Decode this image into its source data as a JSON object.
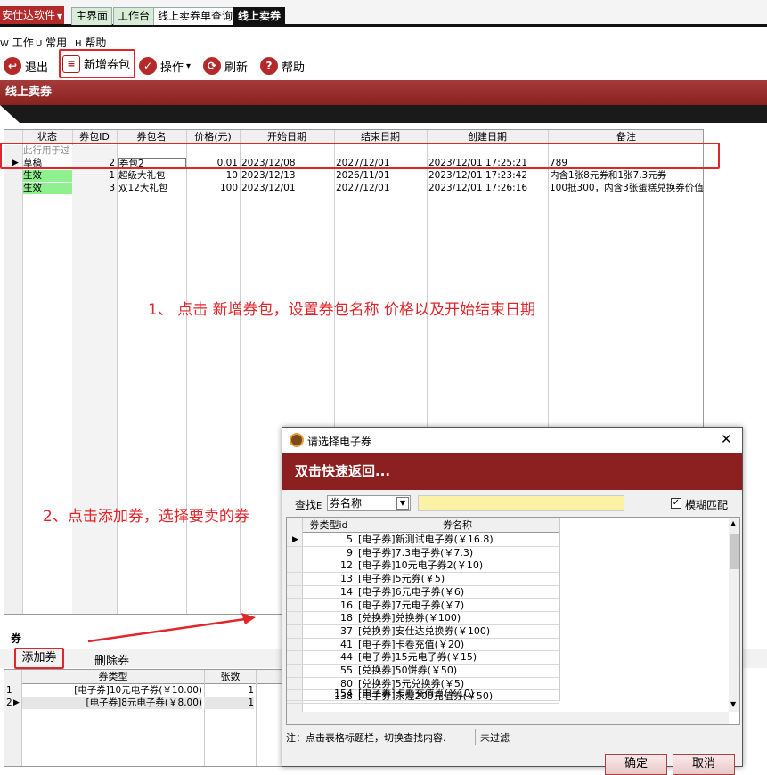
{
  "app": {
    "title": "安仕达软件",
    "dropdown_glyph": "▼"
  },
  "tabs": [
    {
      "label": "主界面",
      "active": false
    },
    {
      "label": "工作台",
      "active": false
    },
    {
      "label": "线上卖券单查询",
      "active": false
    },
    {
      "label": "线上卖券",
      "active": true
    }
  ],
  "menu": [
    {
      "key": "W",
      "label": "工作"
    },
    {
      "key": "U",
      "label": "常用"
    },
    {
      "key": "H",
      "label": "帮助"
    }
  ],
  "toolbar": {
    "exit": "退出",
    "new_package": "新增券包",
    "operate": "操作",
    "operate_caret": "▾",
    "refresh": "刷新",
    "help": "帮助"
  },
  "section_title": "线上卖券",
  "grid": {
    "columns": [
      "状态",
      "券包ID",
      "券包名",
      "价格(元)",
      "开始日期",
      "结束日期",
      "创建日期",
      "备注"
    ],
    "filter_row_text": "此行用于过",
    "rows": [
      {
        "status": "草稿",
        "id": "2",
        "name": "券包2",
        "price": "0.01",
        "start": "2023/12/08",
        "end": "2027/12/01",
        "created": "2023/12/01 17:25:21",
        "note": "789",
        "current": true
      },
      {
        "status": "生效",
        "id": "1",
        "name": "超级大礼包",
        "price": "10",
        "start": "2023/12/13",
        "end": "2026/11/01",
        "created": "2023/12/01 17:23:42",
        "note": "内含1张8元券和1张7.3元券",
        "current": false
      },
      {
        "status": "生效",
        "id": "3",
        "name": "双12大礼包",
        "price": "100",
        "start": "2023/12/01",
        "end": "2027/12/01",
        "created": "2023/12/01 17:26:16",
        "note": "100抵300，内含3张蛋糕兑换券价值3",
        "current": false
      }
    ]
  },
  "annotations": {
    "step1": "1、 点击 新增券包，设置券包名称 价格以及开始结束日期",
    "step2": "2、点击添加券，选择要卖的券"
  },
  "coupon_panel": {
    "title": "券",
    "add_button": "添加券",
    "remove_button": "删除券",
    "columns": [
      "券类型",
      "张数"
    ],
    "rows": [
      {
        "num": "1",
        "type": "[电子券]10元电子券(￥10.00)",
        "count": "1"
      },
      {
        "num": "2",
        "type": "[电子券]8元电子券(￥8.00)",
        "count": "1"
      }
    ]
  },
  "dialog": {
    "title": "请选择电子券",
    "close_glyph": "✕",
    "banner": "双击快速返回...",
    "search_label": "查找",
    "search_hotkey": "E",
    "search_field": "券名称",
    "search_value": "",
    "fuzzy_label": "模糊匹配",
    "fuzzy_checked": true,
    "columns": [
      "券类型id",
      "券名称"
    ],
    "rows": [
      {
        "id": "5",
        "name": "[电子券]新测试电子券(￥16.8)"
      },
      {
        "id": "9",
        "name": "[电子券]7.3电子券(￥7.3)"
      },
      {
        "id": "12",
        "name": "[电子券]10元电子券2(￥10)"
      },
      {
        "id": "13",
        "name": "[电子券]5元券(￥5)"
      },
      {
        "id": "14",
        "name": "[电子券]6元电子券(￥6)"
      },
      {
        "id": "16",
        "name": "[电子券]7元电子券(￥7)"
      },
      {
        "id": "18",
        "name": "[兑换券]兑换券(￥100)"
      },
      {
        "id": "37",
        "name": "[兑换券]安仕达兑换券(￥100)"
      },
      {
        "id": "41",
        "name": "[电子券]卡卷充值(￥20)"
      },
      {
        "id": "44",
        "name": "[电子券]15元电子券(￥15)"
      },
      {
        "id": "55",
        "name": "[兑换券]50饼券(￥50)"
      },
      {
        "id": "80",
        "name": "[兑换券]5元兑换券(￥5)"
      },
      {
        "id": "138",
        "name": "[电子券]永煌200充值券(￥50)"
      },
      {
        "id": "154",
        "name": "[电子券]卡券充值肖(￥10)"
      }
    ],
    "status_hint": "注：点击表格标题栏，切换查找内容.",
    "status_filter": "未过滤",
    "ok": "确定",
    "cancel": "取消"
  },
  "colors": {
    "accent": "#b42a2a",
    "annotation": "#e0262b",
    "active_status": "#8ef08e"
  }
}
